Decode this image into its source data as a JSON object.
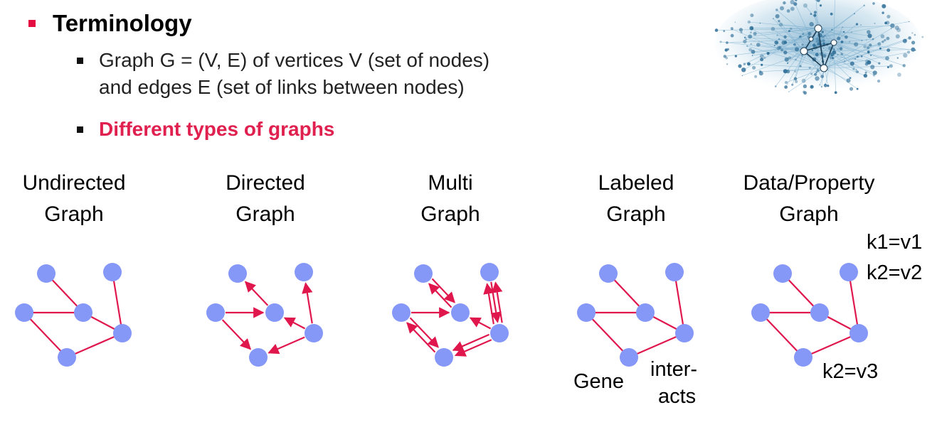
{
  "terminology": "Terminology",
  "bullets": [
    {
      "line1": "Graph G = (V, E) of vertices V (set of nodes)",
      "line2": "and edges E (set of links between nodes)"
    },
    {
      "text": "Different types of graphs"
    }
  ],
  "graph_titles": [
    {
      "l1": "Undirected",
      "l2": "Graph"
    },
    {
      "l1": "Directed",
      "l2": "Graph"
    },
    {
      "l1": "Multi",
      "l2": "Graph"
    },
    {
      "l1": "Labeled",
      "l2": "Graph"
    },
    {
      "l1": "Data/Property",
      "l2": "Graph"
    }
  ],
  "labels": {
    "gene": "Gene",
    "interacts_1": "inter-",
    "interacts_2": "acts",
    "k1v1": "k1=v1",
    "k2v2": "k2=v2",
    "k2v3": "k2=v3"
  },
  "colors": {
    "node": "#8597f7",
    "edge": "#e0174d",
    "accent": "#e30b3f"
  }
}
